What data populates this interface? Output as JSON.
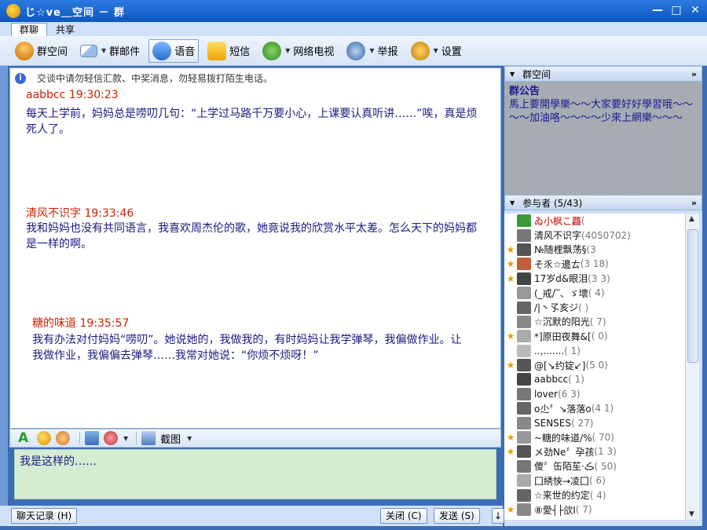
{
  "window": {
    "title": "じ☆ve＿空间 － 群"
  },
  "tabs": [
    "群聊",
    "共享"
  ],
  "toolbar": {
    "group_space": "群空间",
    "group_mail": "群邮件",
    "voice": "语音",
    "sms": "短信",
    "web_tv": "网络电视",
    "report": "举报",
    "settings": "设置"
  },
  "chat": {
    "notice": "交谈中请勿轻信汇款、中奖消息，勿轻易拨打陌生电话。",
    "messages": [
      {
        "sender": "aabbcc",
        "time": "19:30:23",
        "text": "每天上学前，妈妈总是唠叨几句：“上学过马路千万要小心，上课要认真听讲……”唉，真是烦死人了。",
        "color": "#cc2200"
      },
      {
        "sender": "清风不识字",
        "time": "19:33:46",
        "text": "我和妈妈也没有共同语言，我喜欢周杰伦的歌，她竟说我的欣赏水平太差。怎么天下的妈妈都是一样的啊。",
        "color": "#cc2200"
      },
      {
        "sender": "糖的味道",
        "time": "19:35:57",
        "text": "我有办法对付妈妈“唠叨”。她说她的，我做我的，有时妈妈让我学弹琴，我偏做作业。让我做作业，我偏偏去弹琴……我常对她说：“你烦不烦呀！”",
        "color": "#cc2200"
      }
    ]
  },
  "input_toolbar": {
    "screenshot": "截图"
  },
  "input": {
    "value": "我是这样的……"
  },
  "buttons": {
    "history": "聊天记录 (H)",
    "close": "关闭 (C)",
    "send": "发送 (S)"
  },
  "group_space_panel": {
    "header": "群空间",
    "more": "»",
    "announce_title": "群公告",
    "announce_text": "馬上要開學樂～～大家要好好學習哦～～～～加油咯～～～～少來上網樂～～～"
  },
  "members_panel": {
    "header": "参与者 (5/43)",
    "more": "»",
    "members": [
      {
        "name": "ゐ小枫こ龘",
        "qq": "(",
        "star": false,
        "color": "#cc0000"
      },
      {
        "name": "清风不识字",
        "qq": "(4050702)",
        "star": false,
        "color": "#111"
      },
      {
        "name": "№随梩飘荡§",
        "qq": "(3",
        "star": true,
        "color": "#111"
      },
      {
        "name": "そ乑☆邊ㄊ",
        "qq": "(3     18)",
        "star": true,
        "color": "#111"
      },
      {
        "name": "17岁d&眼泪",
        "qq": "(3      3)",
        "star": true,
        "color": "#111"
      },
      {
        "name": "(_戒/‾、ゞ壞",
        "qq": "(     4)",
        "star": false,
        "color": "#111"
      },
      {
        "name": "/|丶孓亥ジ",
        "qq": "(       )",
        "star": false,
        "color": "#111"
      },
      {
        "name": "☆沉默的阳光",
        "qq": "(       7)",
        "star": false,
        "color": "#111"
      },
      {
        "name": "*]原田夜舞&[",
        "qq": "(      0)",
        "star": true,
        "color": "#111"
      },
      {
        "name": "..,.......",
        "qq": "(      1)",
        "star": false,
        "color": "#111"
      },
      {
        "name": "@[↘约锭↙]",
        "qq": "(5      0)",
        "star": true,
        "color": "#111"
      },
      {
        "name": "aabbcc",
        "qq": "(      1)",
        "star": false,
        "color": "#111"
      },
      {
        "name": "lover",
        "qq": "(6      3)",
        "star": false,
        "color": "#111"
      },
      {
        "name": "o尐〞↘落落o",
        "qq": "(4      1)",
        "star": false,
        "color": "#111"
      },
      {
        "name": "SENSES",
        "qq": "(      27)",
        "star": false,
        "color": "#111"
      },
      {
        "name": "~糖的味道/%",
        "qq": "(      70)",
        "star": true,
        "color": "#111"
      },
      {
        "name": "メ劲Ne〞孕孩",
        "qq": "(1      3)",
        "star": true,
        "color": "#111"
      },
      {
        "name": "傻〞缶陌苼·ڪ",
        "qq": "(      50)",
        "star": false,
        "color": "#111"
      },
      {
        "name": "囗綉悏→凌囗",
        "qq": "(      6)",
        "star": false,
        "color": "#111"
      },
      {
        "name": "☆来世的约定",
        "qq": "(      4)",
        "star": false,
        "color": "#111"
      },
      {
        "name": "⑧愛┤├欱Ⅰ",
        "qq": "(      7)",
        "star": true,
        "color": "#111"
      }
    ]
  }
}
